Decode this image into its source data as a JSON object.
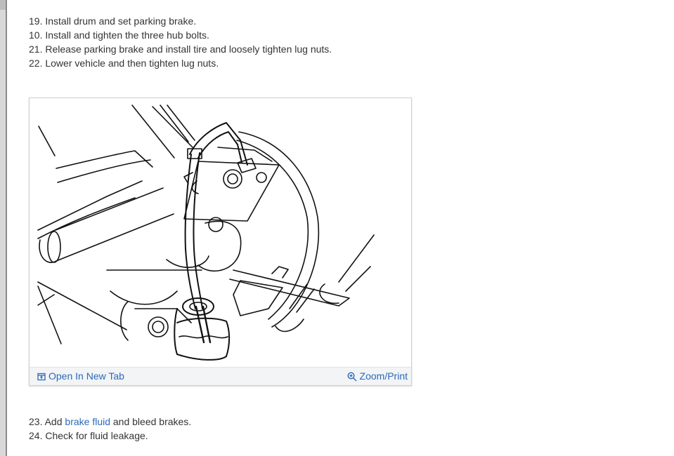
{
  "steps_top": [
    {
      "number": "19.",
      "text": "Install drum and set parking brake."
    },
    {
      "number": "10.",
      "text": "Install and tighten the three hub bolts."
    },
    {
      "number": "21.",
      "text": "Release parking brake and install tire and loosely tighten lug nuts."
    },
    {
      "number": "22.",
      "text": "Lower vehicle and then tighten lug nuts."
    }
  ],
  "figure": {
    "open_label": "Open In New Tab",
    "zoom_label": "Zoom/Print"
  },
  "steps_bottom": [
    {
      "number": "23.",
      "before": "Add ",
      "link": "brake fluid",
      "after": " and bleed brakes."
    },
    {
      "number": "24.",
      "text": "Check for fluid leakage."
    }
  ],
  "colors": {
    "link": "#2a6ab8",
    "body_text": "#333333",
    "figure_bar": "#f3f4f6"
  },
  "icons": {
    "open": "open-new-tab-icon",
    "zoom": "zoom-in-icon"
  }
}
